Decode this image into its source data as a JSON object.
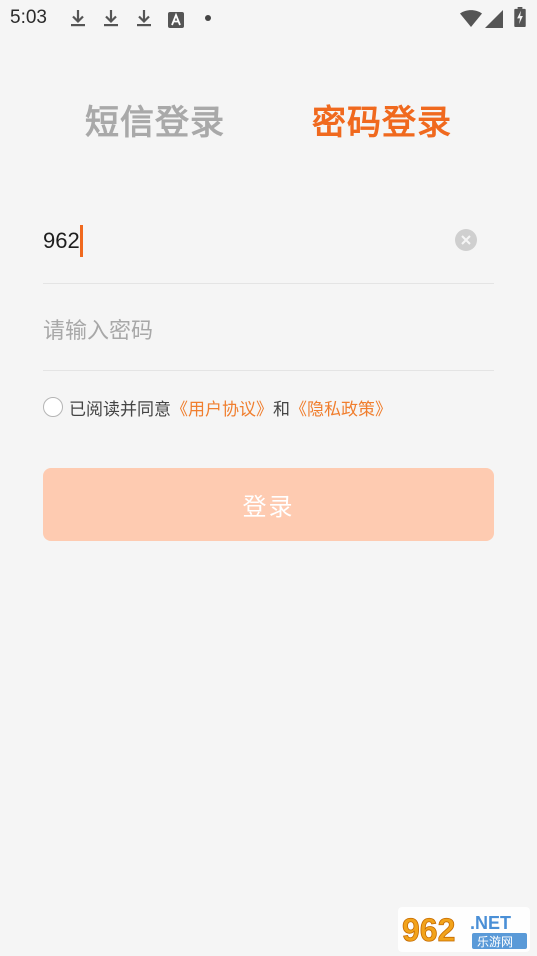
{
  "status_bar": {
    "time": "5:03",
    "icons": [
      "download-icon",
      "download-icon",
      "download-icon",
      "accessibility-a-icon",
      "dot-icon",
      "wifi-icon",
      "cell-signal-icon",
      "battery-charging-icon"
    ]
  },
  "tabs": [
    {
      "label": "短信登录",
      "active": false
    },
    {
      "label": "密码登录",
      "active": true
    }
  ],
  "phone_field": {
    "value": "962"
  },
  "password_field": {
    "placeholder": "请输入密码"
  },
  "agreement": {
    "prefix": "已阅读并同意",
    "user_agreement": "《用户协议》",
    "conjunction": "和",
    "privacy_policy": "《隐私政策》",
    "checked": false
  },
  "login_button": {
    "label": "登录"
  },
  "watermark": {
    "brand": "962.NET",
    "subtitle": "乐游网"
  },
  "colors": {
    "accent": "#f0691e",
    "link": "#f07e2e",
    "button_disabled": "#fecbb1",
    "inactive_tab": "#a9a9a9",
    "background": "#f5f5f5"
  }
}
